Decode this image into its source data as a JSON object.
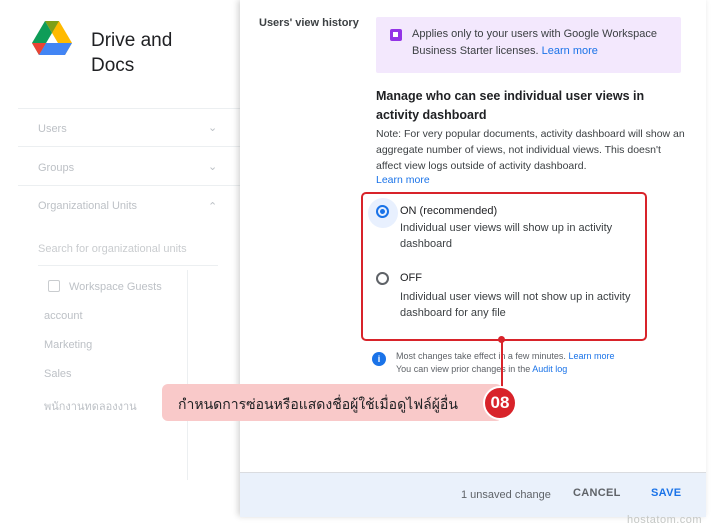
{
  "sidebar": {
    "app_title": "Drive and Docs",
    "nav": [
      "Users",
      "Groups",
      "Organizational Units"
    ],
    "search_placeholder": "Search for organizational units",
    "org_units": [
      "Workspace Guests",
      "account",
      "Marketing",
      "Sales",
      "พนักงานทดลองงาน"
    ]
  },
  "panel": {
    "section_label": "Users' view history",
    "notice": {
      "text": "Applies only to your users with Google Workspace Business Starter licenses.",
      "link": "Learn more"
    },
    "heading": "Manage who can see individual user views in activity dashboard",
    "note": "Note: For very popular documents, activity dashboard will show an aggregate number of views, not individual views. This doesn't affect view logs outside of activity dashboard.",
    "note_link": "Learn more",
    "options": [
      {
        "label": "ON (recommended)",
        "description": "Individual user views will show up in activity dashboard",
        "selected": true
      },
      {
        "label": "OFF",
        "description": "Individual user views will not show up in activity dashboard for any file",
        "selected": false
      }
    ],
    "info": {
      "line1": "Most changes take effect in a few minutes.",
      "line1_link": "Learn more",
      "line2": "You can view prior changes in the",
      "line2_link": "Audit log"
    },
    "footer": {
      "unsaved": "1 unsaved change",
      "cancel": "CANCEL",
      "save": "SAVE"
    }
  },
  "callout": {
    "text": "กำหนดการซ่อนหรือแสดงชื่อผู้ใช้เมื่อดูไฟล์ผู้อื่น",
    "badge": "08"
  },
  "watermark": "hostatom.com",
  "colors": {
    "accent": "#1a73e8",
    "highlight_red": "#d8232a",
    "notice_bg": "#f3e8fd",
    "footer_bg": "#eaf1fb",
    "callout_bg": "#f9c9c9"
  }
}
